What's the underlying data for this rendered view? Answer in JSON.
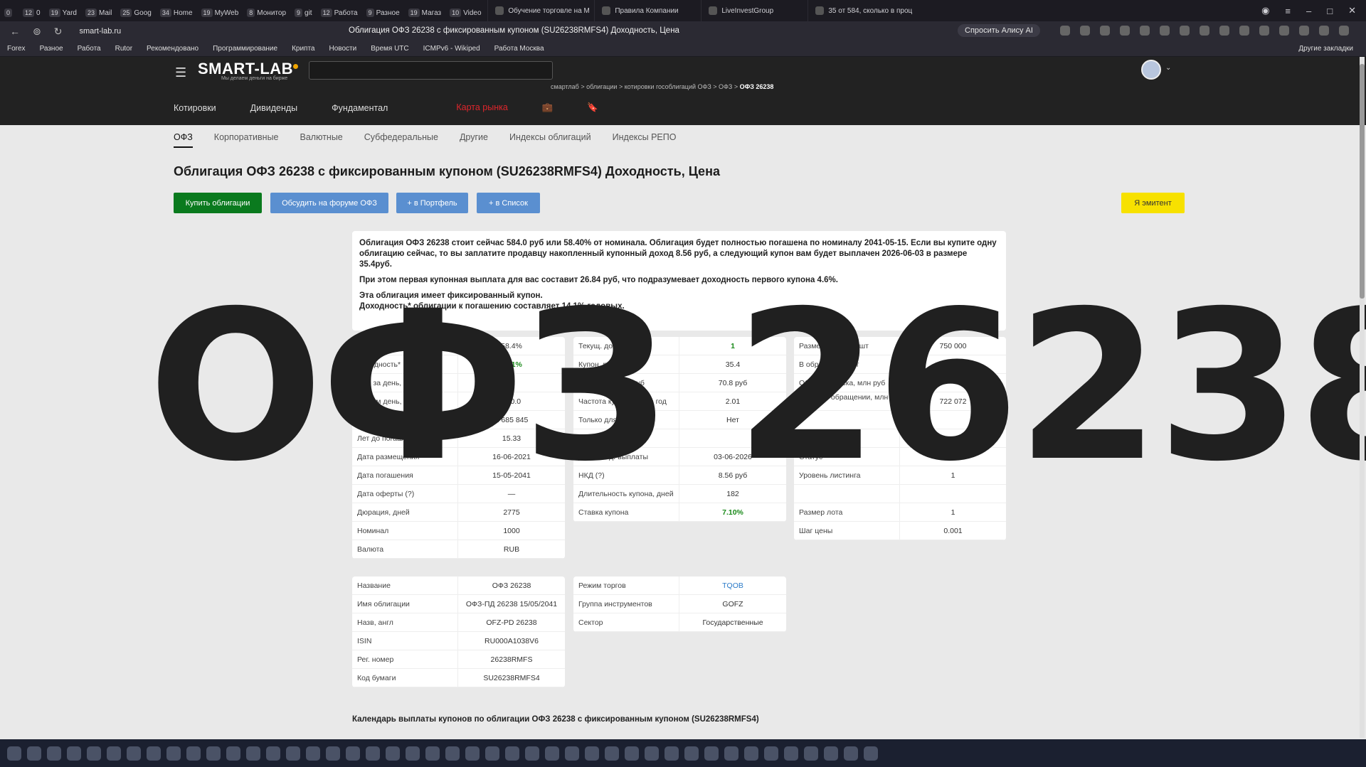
{
  "browser": {
    "pinned_tabs": [
      {
        "count": "0",
        "label": ""
      },
      {
        "count": "12",
        "label": "0"
      },
      {
        "count": "19",
        "label": "Yard"
      },
      {
        "count": "23",
        "label": "Mail"
      },
      {
        "count": "25",
        "label": "Goog"
      },
      {
        "count": "34",
        "label": "Home"
      },
      {
        "count": "19",
        "label": "MyWeb"
      },
      {
        "count": "8",
        "label": "Монитор"
      },
      {
        "count": "9",
        "label": "git"
      },
      {
        "count": "12",
        "label": "Работа"
      },
      {
        "count": "9",
        "label": "Разное"
      },
      {
        "count": "19",
        "label": "Магаз"
      },
      {
        "count": "10",
        "label": "Video"
      }
    ],
    "tabs": [
      "Обучение торговле на М",
      "Правила Компании",
      "LiveInvestGroup",
      "35 от 584, сколько в проц"
    ],
    "url": "smart-lab.ru",
    "page_title": "Облигация ОФЗ 26238 с фиксированным купоном (SU26238RMFS4) Доходность, Цена",
    "alice": "Спросить Алису AI",
    "bookmarks": [
      "Forex",
      "Разное",
      "Работа",
      "Rutor",
      "Рекомендовано",
      "Программирование",
      "Крипта",
      "Новости",
      "Время UTC",
      "ICMPv6 - Wikiped",
      "Работа Москва"
    ],
    "other_bookmarks": "Другие закладки"
  },
  "site": {
    "logo": "SMART-LAB",
    "tagline": "Мы делаем деньги на бирже",
    "breadcrumbs": [
      "смартлаб",
      "облигации",
      "котировки гособлигаций ОФЗ",
      "ОФЗ"
    ],
    "breadcrumb_current": "ОФЗ 26238",
    "menu": [
      "Котировки",
      "Дивиденды",
      "Фундаментал"
    ],
    "menu_red": "Карта рынка",
    "subnav": [
      "ОФЗ",
      "Корпоративные",
      "Валютные",
      "Субфедеральные",
      "Другие",
      "Индексы облигаций",
      "Индексы РЕПО"
    ]
  },
  "page": {
    "title": "Облигация ОФЗ 26238 с фиксированным купоном (SU26238RMFS4) Доходность, Цена",
    "buttons": {
      "buy": "Купить облигации",
      "forum": "Обсудить на форуме ОФЗ",
      "portfolio": "+ в Портфель",
      "list": "+ в Список",
      "issuer": "Я эмитент"
    },
    "desc": [
      "Облигация ОФЗ 26238 стоит сейчас 584.0 руб или 58.40% от номинала. Облигация будет полностью погашена по номиналу 2041-05-15. Если вы купите одну облигацию сейчас, то вы заплатите продавцу накопленный купонный доход 8.56 руб, а следующий купон вам будет выплачен 2026-06-03 в размере 35.4руб.",
      "При этом первая купонная выплата для вас составит 26.84 руб, что подразумевает доходность первого купона 4.6%.",
      "Эта облигация имеет фиксированный купон.",
      "Доходность* облигации к погашению составляет 14.1% годовых."
    ],
    "table1": [
      {
        "k": "Котировка облигации",
        "v": "58.4%"
      },
      {
        "k": "Доходность*",
        "v": "14.1%",
        "green": true
      },
      {
        "k": "Изм за день, %",
        "v": ""
      },
      {
        "k": "Объем день, млн. руб",
        "v": "980.0"
      },
      {
        "k": "",
        "v": "1 685 845"
      },
      {
        "k": "Лет до погашения",
        "v": "15.33"
      },
      {
        "k": "Дата размещения",
        "v": "16-06-2021"
      },
      {
        "k": "Дата погашения",
        "v": "15-05-2041"
      },
      {
        "k": "Дата оферты (?)",
        "v": "—"
      },
      {
        "k": "Дюрация, дней",
        "v": "2775"
      },
      {
        "k": "Номинал",
        "v": "1000"
      },
      {
        "k": "Валюта",
        "v": "RUB"
      }
    ],
    "table2": [
      {
        "k": "Текущ. дох. купона",
        "v": "1",
        "green": true
      },
      {
        "k": "Купон, руб (?)",
        "v": "35.4"
      },
      {
        "k": "Годовой купон, руб",
        "v": "70.8 руб"
      },
      {
        "k": "Частота купона, раз в год",
        "v": "2.01"
      },
      {
        "k": "Только для квалов?",
        "v": "Нет"
      },
      {
        "k": "",
        "v": ""
      },
      {
        "k": "Дата след. выплаты",
        "v": "03-06-2026"
      },
      {
        "k": "НКД (?)",
        "v": "8.56 руб"
      },
      {
        "k": "Длительность купона, дней",
        "v": "182"
      },
      {
        "k": "Ставка купона",
        "v": "7.10%",
        "green": true
      }
    ],
    "table3": [
      {
        "k": "Размер выпуска, шт",
        "v": "750 000"
      },
      {
        "k": "В обращении, шт",
        "v": "722 07"
      },
      {
        "k": "Объем выпуска, млн руб",
        "v": ""
      },
      {
        "k": "Объем в обращении, млн руб",
        "v": "722 072"
      },
      {
        "k": "",
        "v": ""
      },
      {
        "k": "",
        "v": "Безадрес. (TQOB)"
      },
      {
        "k": "Статус",
        "v": "А"
      },
      {
        "k": "Уровень листинга",
        "v": "1"
      },
      {
        "k": "",
        "v": ""
      },
      {
        "k": "Размер лота",
        "v": "1"
      },
      {
        "k": "Шаг цены",
        "v": "0.001"
      }
    ],
    "table4": [
      {
        "k": "Название",
        "v": "ОФЗ 26238"
      },
      {
        "k": "Имя облигации",
        "v": "ОФЗ-ПД 26238 15/05/2041"
      },
      {
        "k": "Назв, англ",
        "v": "OFZ-PD 26238"
      },
      {
        "k": "ISIN",
        "v": "RU000A1038V6"
      },
      {
        "k": "Рег. номер",
        "v": "26238RMFS"
      },
      {
        "k": "Код бумаги",
        "v": "SU26238RMFS4"
      }
    ],
    "table5": [
      {
        "k": "Режим торгов",
        "v": "TQOB",
        "link": true
      },
      {
        "k": "Группа инструментов",
        "v": "GOFZ"
      },
      {
        "k": "Сектор",
        "v": "Государственные"
      }
    ],
    "calendar_title": "Календарь выплаты купонов по облигации ОФЗ 26238 с фиксированным купоном (SU26238RMFS4)"
  },
  "overlay_text": "ОФЗ 26238"
}
